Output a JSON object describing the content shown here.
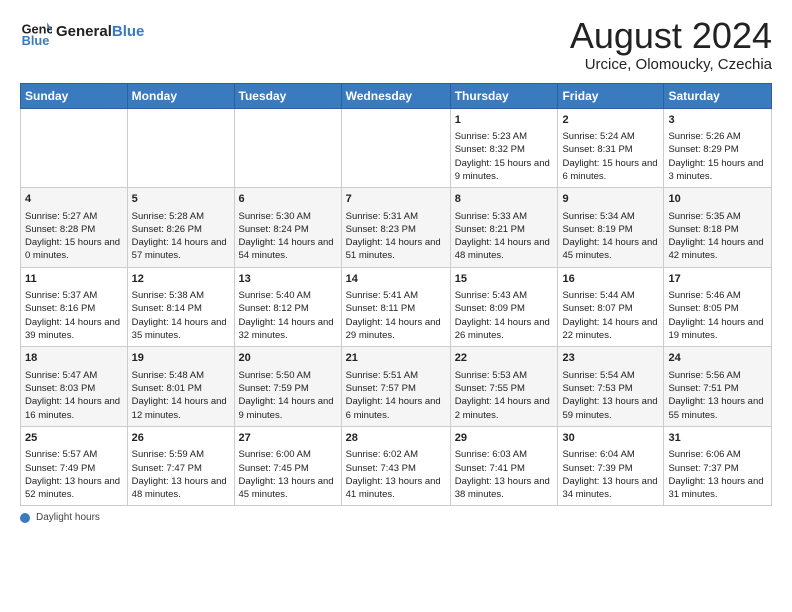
{
  "header": {
    "logo_general": "General",
    "logo_blue": "Blue",
    "main_title": "August 2024",
    "subtitle": "Urcice, Olomoucky, Czechia"
  },
  "days_of_week": [
    "Sunday",
    "Monday",
    "Tuesday",
    "Wednesday",
    "Thursday",
    "Friday",
    "Saturday"
  ],
  "weeks": [
    [
      {
        "day": "",
        "info": ""
      },
      {
        "day": "",
        "info": ""
      },
      {
        "day": "",
        "info": ""
      },
      {
        "day": "",
        "info": ""
      },
      {
        "day": "1",
        "info": "Sunrise: 5:23 AM\nSunset: 8:32 PM\nDaylight: 15 hours and 9 minutes."
      },
      {
        "day": "2",
        "info": "Sunrise: 5:24 AM\nSunset: 8:31 PM\nDaylight: 15 hours and 6 minutes."
      },
      {
        "day": "3",
        "info": "Sunrise: 5:26 AM\nSunset: 8:29 PM\nDaylight: 15 hours and 3 minutes."
      }
    ],
    [
      {
        "day": "4",
        "info": "Sunrise: 5:27 AM\nSunset: 8:28 PM\nDaylight: 15 hours and 0 minutes."
      },
      {
        "day": "5",
        "info": "Sunrise: 5:28 AM\nSunset: 8:26 PM\nDaylight: 14 hours and 57 minutes."
      },
      {
        "day": "6",
        "info": "Sunrise: 5:30 AM\nSunset: 8:24 PM\nDaylight: 14 hours and 54 minutes."
      },
      {
        "day": "7",
        "info": "Sunrise: 5:31 AM\nSunset: 8:23 PM\nDaylight: 14 hours and 51 minutes."
      },
      {
        "day": "8",
        "info": "Sunrise: 5:33 AM\nSunset: 8:21 PM\nDaylight: 14 hours and 48 minutes."
      },
      {
        "day": "9",
        "info": "Sunrise: 5:34 AM\nSunset: 8:19 PM\nDaylight: 14 hours and 45 minutes."
      },
      {
        "day": "10",
        "info": "Sunrise: 5:35 AM\nSunset: 8:18 PM\nDaylight: 14 hours and 42 minutes."
      }
    ],
    [
      {
        "day": "11",
        "info": "Sunrise: 5:37 AM\nSunset: 8:16 PM\nDaylight: 14 hours and 39 minutes."
      },
      {
        "day": "12",
        "info": "Sunrise: 5:38 AM\nSunset: 8:14 PM\nDaylight: 14 hours and 35 minutes."
      },
      {
        "day": "13",
        "info": "Sunrise: 5:40 AM\nSunset: 8:12 PM\nDaylight: 14 hours and 32 minutes."
      },
      {
        "day": "14",
        "info": "Sunrise: 5:41 AM\nSunset: 8:11 PM\nDaylight: 14 hours and 29 minutes."
      },
      {
        "day": "15",
        "info": "Sunrise: 5:43 AM\nSunset: 8:09 PM\nDaylight: 14 hours and 26 minutes."
      },
      {
        "day": "16",
        "info": "Sunrise: 5:44 AM\nSunset: 8:07 PM\nDaylight: 14 hours and 22 minutes."
      },
      {
        "day": "17",
        "info": "Sunrise: 5:46 AM\nSunset: 8:05 PM\nDaylight: 14 hours and 19 minutes."
      }
    ],
    [
      {
        "day": "18",
        "info": "Sunrise: 5:47 AM\nSunset: 8:03 PM\nDaylight: 14 hours and 16 minutes."
      },
      {
        "day": "19",
        "info": "Sunrise: 5:48 AM\nSunset: 8:01 PM\nDaylight: 14 hours and 12 minutes."
      },
      {
        "day": "20",
        "info": "Sunrise: 5:50 AM\nSunset: 7:59 PM\nDaylight: 14 hours and 9 minutes."
      },
      {
        "day": "21",
        "info": "Sunrise: 5:51 AM\nSunset: 7:57 PM\nDaylight: 14 hours and 6 minutes."
      },
      {
        "day": "22",
        "info": "Sunrise: 5:53 AM\nSunset: 7:55 PM\nDaylight: 14 hours and 2 minutes."
      },
      {
        "day": "23",
        "info": "Sunrise: 5:54 AM\nSunset: 7:53 PM\nDaylight: 13 hours and 59 minutes."
      },
      {
        "day": "24",
        "info": "Sunrise: 5:56 AM\nSunset: 7:51 PM\nDaylight: 13 hours and 55 minutes."
      }
    ],
    [
      {
        "day": "25",
        "info": "Sunrise: 5:57 AM\nSunset: 7:49 PM\nDaylight: 13 hours and 52 minutes."
      },
      {
        "day": "26",
        "info": "Sunrise: 5:59 AM\nSunset: 7:47 PM\nDaylight: 13 hours and 48 minutes."
      },
      {
        "day": "27",
        "info": "Sunrise: 6:00 AM\nSunset: 7:45 PM\nDaylight: 13 hours and 45 minutes."
      },
      {
        "day": "28",
        "info": "Sunrise: 6:02 AM\nSunset: 7:43 PM\nDaylight: 13 hours and 41 minutes."
      },
      {
        "day": "29",
        "info": "Sunrise: 6:03 AM\nSunset: 7:41 PM\nDaylight: 13 hours and 38 minutes."
      },
      {
        "day": "30",
        "info": "Sunrise: 6:04 AM\nSunset: 7:39 PM\nDaylight: 13 hours and 34 minutes."
      },
      {
        "day": "31",
        "info": "Sunrise: 6:06 AM\nSunset: 7:37 PM\nDaylight: 13 hours and 31 minutes."
      }
    ]
  ],
  "footer": {
    "label": "Daylight hours"
  }
}
